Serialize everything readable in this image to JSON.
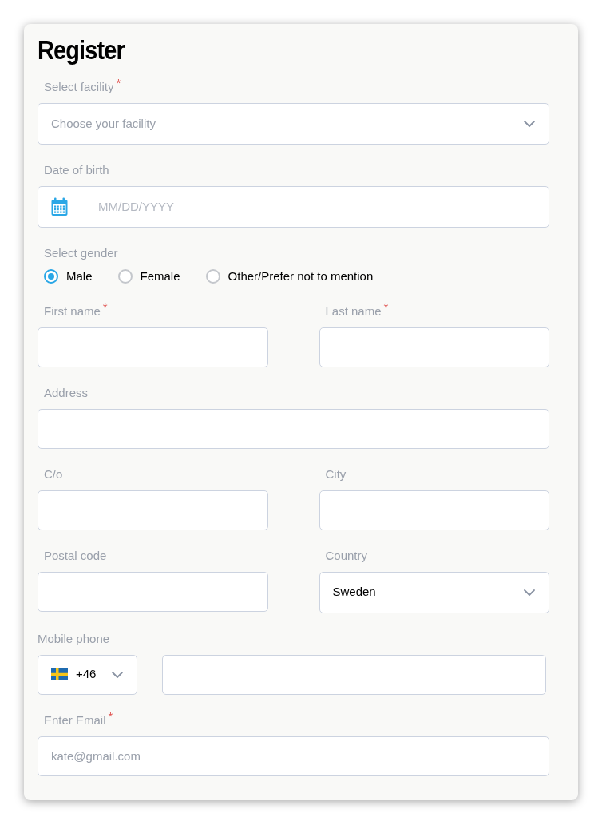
{
  "title": "Register",
  "rows": [
    {
      "fields": [
        {
          "kind": "select",
          "label": "Select facility",
          "required_mark": "*",
          "placeholder": "Choose your facility"
        }
      ]
    },
    {
      "fields": [
        {
          "kind": "date",
          "label": "Date of birth",
          "placeholder": "MM/DD/YYYY"
        }
      ]
    },
    {
      "fields": [
        {
          "kind": "radio_group",
          "label": "Select gender",
          "options": [
            {
              "label": "Male",
              "selected": true
            },
            {
              "label": "Female",
              "selected": false
            },
            {
              "label": "Other/Prefer not to mention",
              "selected": false
            }
          ]
        }
      ]
    },
    {
      "fields": [
        {
          "kind": "text",
          "label": "First name",
          "required_mark": "*"
        },
        {
          "kind": "text",
          "label": "Last name",
          "required_mark": "*"
        }
      ]
    },
    {
      "fields": [
        {
          "kind": "text",
          "label": "Address"
        }
      ]
    },
    {
      "fields": [
        {
          "kind": "text",
          "label": "C/o"
        },
        {
          "kind": "text",
          "label": "City"
        }
      ]
    },
    {
      "fields": [
        {
          "kind": "text",
          "label": "Postal code"
        },
        {
          "kind": "select",
          "label": "Country",
          "value": "Sweden"
        }
      ]
    },
    {
      "fields": [
        {
          "kind": "phone",
          "label": "Mobile phone",
          "code": "+46"
        }
      ]
    },
    {
      "fields": [
        {
          "kind": "text",
          "label": "Enter Email",
          "required_mark": "*",
          "placeholder": "kate@gmail.com"
        }
      ]
    }
  ]
}
